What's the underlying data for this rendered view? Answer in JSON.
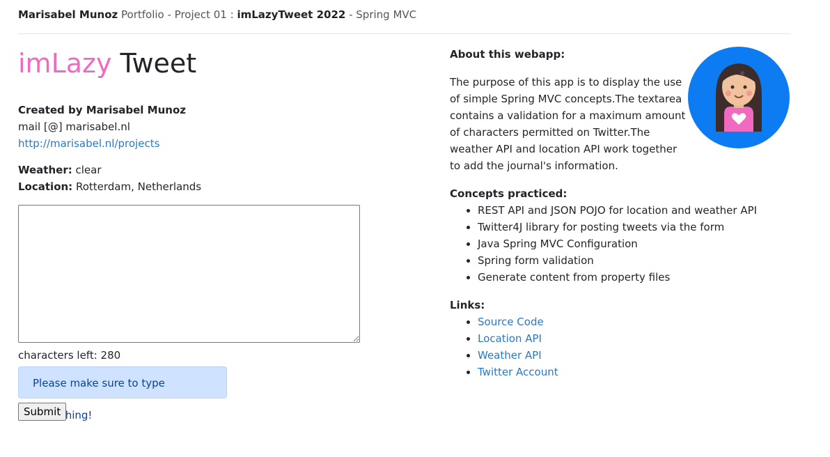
{
  "header": {
    "author": "Marisabel Munoz",
    "portfolio_text": " Portfolio - Project 01 : ",
    "project_name": "imLazyTweet 2022",
    "suffix": " - Spring MVC"
  },
  "title": {
    "part1": "imLazy",
    "part2": " Tweet"
  },
  "creator": {
    "label": "Created by Marisabel Munoz",
    "mail": "mail [@] marisabel.nl",
    "link": "http://marisabel.nl/projects"
  },
  "weather": {
    "label": "Weather:",
    "value": " clear"
  },
  "location": {
    "label": "Location:",
    "value": " Rotterdam, Netherlands"
  },
  "tweet_form": {
    "textarea_value": "",
    "chars_left": "characters left: 280",
    "alert": "Please make sure to type something!",
    "submit_label": "Submit"
  },
  "about": {
    "heading": "About this webapp:",
    "text": "The purpose of this app is to display the use of simple Spring MVC concepts.The textarea contains a validation for a maximum amount of characters permitted on Twitter.The weather API and location API work together to add the journal's information."
  },
  "concepts": {
    "heading": "Concepts practiced:",
    "items": [
      "REST API and JSON POJO for location and weather API",
      "Twitter4J library for posting tweets via the form",
      "Java Spring MVC Configuration",
      "Spring form validation",
      "Generate content from property files"
    ]
  },
  "links": {
    "heading": "Links:",
    "items": [
      "Source Code",
      "Location API",
      "Weather API",
      "Twitter Account"
    ]
  },
  "colors": {
    "accent_pink": "#f16ac0",
    "link_blue": "#2a78c9",
    "avatar_bg": "#0d7cf2",
    "alert_bg": "#cfe2ff"
  },
  "icons": {
    "avatar": "girl-avatar-icon"
  }
}
